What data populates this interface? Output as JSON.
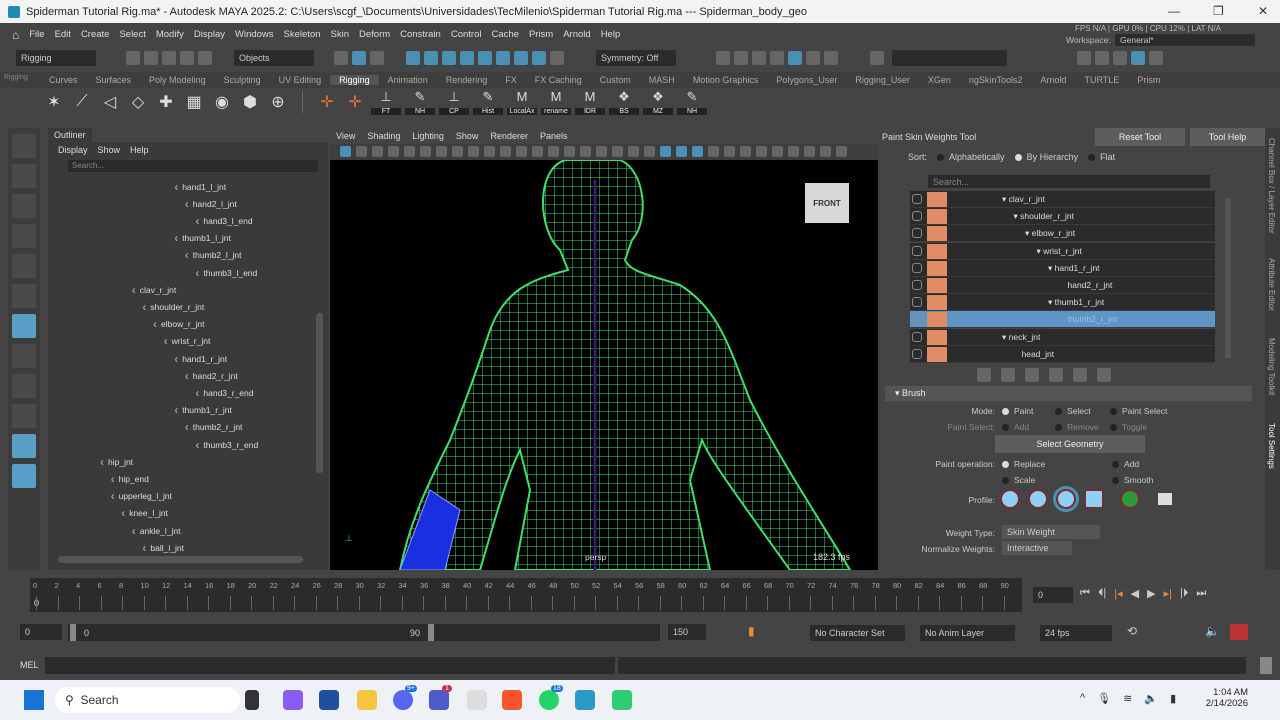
{
  "title": {
    "text": "Spiderman Tutorial Rig.ma* - Autodesk MAYA 2025.2: C:\\Users\\scgf_\\Documents\\Universidades\\TecMilenio\\Spiderman Tutorial Rig.ma  ---  Spiderman_body_geo",
    "minimize": "—",
    "restore": "❐",
    "close": "✕"
  },
  "menu": [
    "File",
    "Edit",
    "Create",
    "Select",
    "Modify",
    "Display",
    "Windows",
    "Skeleton",
    "Skin",
    "Deform",
    "Constrain",
    "Control",
    "Cache",
    "Prism",
    "Arnold",
    "Help"
  ],
  "status": {
    "menuset": "Rigging",
    "objects": "Objects",
    "symmetry": "Symmetry: Off",
    "workspace_label": "Workspace:",
    "workspace": "General*",
    "perf": "FPS N/A | GPU 0% | CPU 12% | LAT N/A"
  },
  "shelf_tabs": [
    "Curves",
    "Surfaces",
    "Poly Modeling",
    "Sculpting",
    "UV Editing",
    "Rigging",
    "Animation",
    "Rendering",
    "FX",
    "FX Caching",
    "Custom",
    "MASH",
    "Motion Graphics",
    "Polygons_User",
    "Rigging_User",
    "XGen",
    "ngSkinTools2",
    "Arnold",
    "TURTLE",
    "Prism"
  ],
  "shelf_active": "Rigging",
  "shelf_labels": [
    "FT",
    "NH",
    "CP",
    "Hist",
    "LocalAx",
    "rename",
    "IDR",
    "BS",
    "MZ",
    "NH"
  ],
  "outliner": {
    "tab": "Outliner",
    "menu": [
      "Display",
      "Show",
      "Help"
    ],
    "search_placeholder": "Search...",
    "items": [
      {
        "name": "hand1_l_jnt",
        "depth": 7
      },
      {
        "name": "hand2_l_jnt",
        "depth": 8
      },
      {
        "name": "hand3_l_end",
        "depth": 9
      },
      {
        "name": "thumb1_l_jnt",
        "depth": 7
      },
      {
        "name": "thumb2_l_jnt",
        "depth": 8
      },
      {
        "name": "thumb3_l_end",
        "depth": 9
      },
      {
        "name": "clav_r_jnt",
        "depth": 3
      },
      {
        "name": "shoulder_r_jnt",
        "depth": 4
      },
      {
        "name": "elbow_r_jnt",
        "depth": 5
      },
      {
        "name": "wrist_r_jnt",
        "depth": 6
      },
      {
        "name": "hand1_r_jnt",
        "depth": 7
      },
      {
        "name": "hand2_r_jnt",
        "depth": 8
      },
      {
        "name": "hand3_r_end",
        "depth": 9
      },
      {
        "name": "thumb1_r_jnt",
        "depth": 7
      },
      {
        "name": "thumb2_r_jnt",
        "depth": 8
      },
      {
        "name": "thumb3_r_end",
        "depth": 9
      },
      {
        "name": "hip_jnt",
        "depth": 0
      },
      {
        "name": "hip_end",
        "depth": 1
      },
      {
        "name": "upperleg_l_jnt",
        "depth": 1
      },
      {
        "name": "knee_l_jnt",
        "depth": 2
      },
      {
        "name": "ankle_l_jnt",
        "depth": 3
      },
      {
        "name": "ball_l_jnt",
        "depth": 4
      }
    ]
  },
  "viewport": {
    "menu": [
      "View",
      "Shading",
      "Lighting",
      "Show",
      "Renderer",
      "Panels"
    ],
    "camera": "persp",
    "fps": "182.3 fps",
    "viewcube": "FRONT"
  },
  "tool": {
    "title": "Paint Skin Weights Tool",
    "reset": "Reset Tool",
    "help": "Tool Help",
    "sort_label": "Sort:",
    "sort": [
      "Alphabetically",
      "By Hierarchy",
      "Flat"
    ],
    "sort_selected": 1,
    "search_placeholder": "Search...",
    "influences": [
      {
        "name": "clav_r_jnt",
        "depth": 0,
        "arrow": true
      },
      {
        "name": "shoulder_r_jnt",
        "depth": 1,
        "arrow": true
      },
      {
        "name": "elbow_r_jnt",
        "depth": 2,
        "arrow": true
      },
      {
        "name": "wrist_r_jnt",
        "depth": 3,
        "arrow": true
      },
      {
        "name": "hand1_r_jnt",
        "depth": 4,
        "arrow": true
      },
      {
        "name": "hand2_r_jnt",
        "depth": 5,
        "arrow": false
      },
      {
        "name": "thumb1_r_jnt",
        "depth": 4,
        "arrow": true
      },
      {
        "name": "thumb2_r_jnt",
        "depth": 5,
        "arrow": false,
        "selected": true
      },
      {
        "name": "neck_jnt",
        "depth": 0,
        "arrow": true
      },
      {
        "name": "head_jnt",
        "depth": 1,
        "arrow": false
      }
    ],
    "brush": {
      "section": "Brush",
      "mode_label": "Mode:",
      "modes": [
        "Paint",
        "Select",
        "Paint Select"
      ],
      "paint_select_label": "Paint Select:",
      "paint_select": [
        "Add",
        "Remove",
        "Toggle"
      ],
      "select_geometry": "Select Geometry",
      "op_label": "Paint operation:",
      "ops": [
        "Replace",
        "Add",
        "Scale",
        "Smooth"
      ],
      "profile_label": "Profile:",
      "weight_type_label": "Weight Type:",
      "weight_type": "Skin Weight",
      "normalize_label": "Normalize Weights:",
      "normalize": "Interactive"
    }
  },
  "side_tabs": [
    "Channel Box / Layer Editor",
    "Attribute Editor",
    "Modeling Toolkit",
    "Tool Settings"
  ],
  "timeline": {
    "current": "0",
    "frame_field": "0",
    "ticks": [
      0,
      2,
      4,
      6,
      8,
      10,
      12,
      14,
      16,
      18,
      20,
      22,
      24,
      26,
      28,
      30,
      32,
      34,
      36,
      38,
      40,
      42,
      44,
      46,
      48,
      50,
      52,
      54,
      56,
      58,
      60,
      62,
      64,
      66,
      68,
      70,
      72,
      74,
      76,
      78,
      80,
      82,
      84,
      86,
      88,
      90
    ]
  },
  "range": {
    "start": "0",
    "inner_start": "0",
    "inner_end": "90",
    "end": "150",
    "character_set": "No Character Set",
    "anim_layer": "No Anim Layer",
    "fps": "24 fps"
  },
  "command": {
    "label": "MEL"
  },
  "taskbar": {
    "search": "Search",
    "time": "1:04 AM",
    "date": "2/14/2026",
    "badges": [
      "9+",
      "1",
      "18"
    ]
  }
}
